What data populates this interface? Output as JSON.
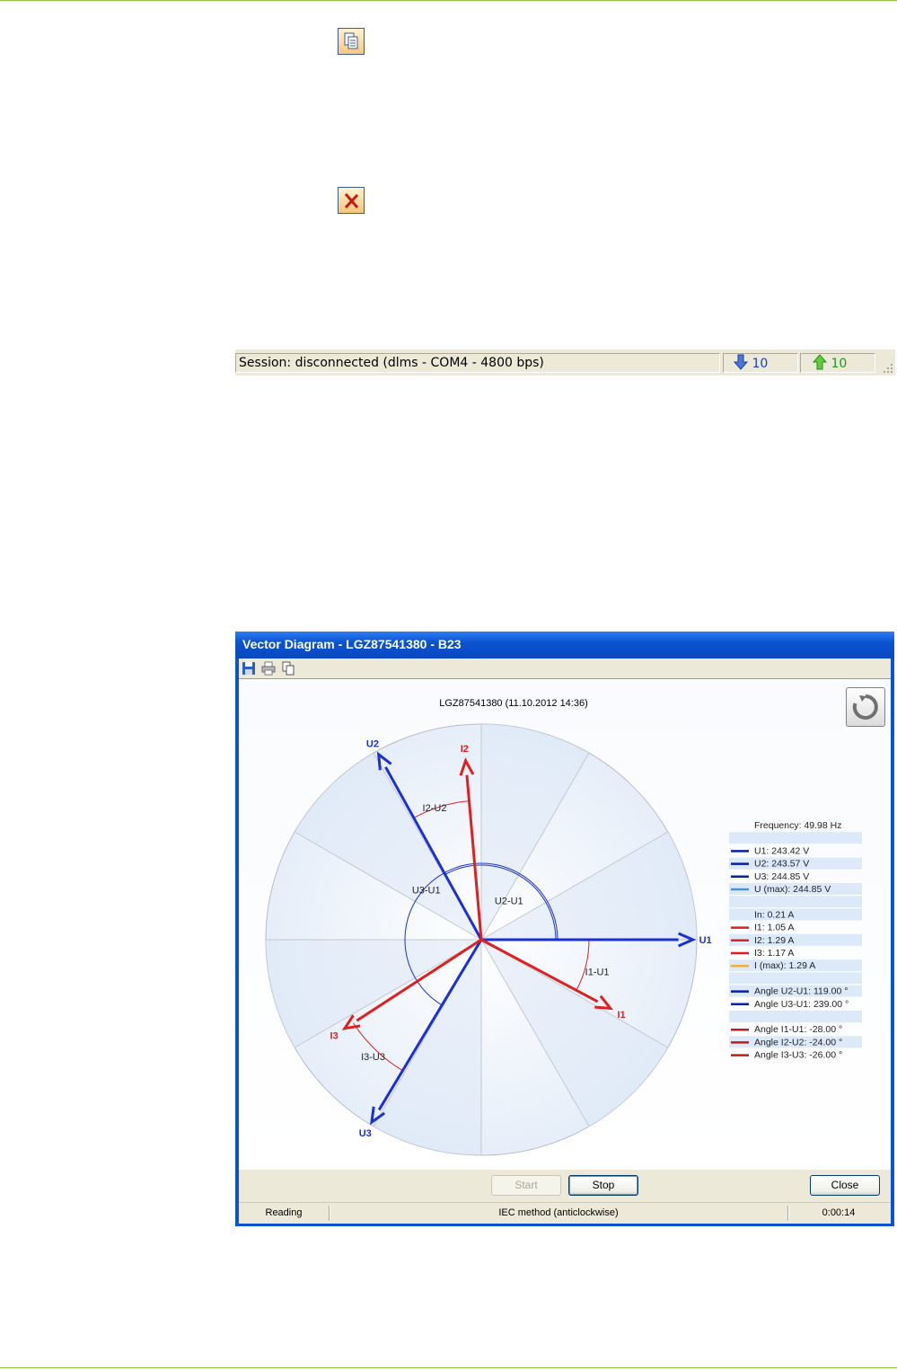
{
  "statusbar": {
    "session_text": "Session: disconnected (dlms - COM4 - 4800 bps)",
    "down_count": "10",
    "up_count": "10"
  },
  "dialog": {
    "title": "Vector Diagram - LGZ87541380 - B23",
    "chart_title": "LGZ87541380 (11.10.2012 14:36)",
    "buttons": {
      "start": "Start",
      "stop": "Stop",
      "close": "Close"
    },
    "status": {
      "state": "Reading",
      "method": "IEC method (anticlockwise)",
      "elapsed": "0:00:14"
    }
  },
  "chart_data": {
    "type": "vector",
    "vectors": [
      {
        "name": "U1",
        "kind": "voltage",
        "angle_deg": 0,
        "magnitude": 243.42,
        "color": "#1a2fd6"
      },
      {
        "name": "U2",
        "kind": "voltage",
        "angle_deg": 119,
        "magnitude": 243.57,
        "color": "#1a2fd6"
      },
      {
        "name": "U3",
        "kind": "voltage",
        "angle_deg": 239,
        "magnitude": 244.85,
        "color": "#1a2fd6"
      },
      {
        "name": "I1",
        "kind": "current",
        "angle_deg": -28,
        "magnitude": 1.05,
        "color": "#e02020"
      },
      {
        "name": "I2",
        "kind": "current",
        "angle_deg": 95,
        "magnitude": 1.29,
        "color": "#e02020"
      },
      {
        "name": "I3",
        "kind": "current",
        "angle_deg": 213,
        "magnitude": 1.17,
        "color": "#e02020"
      }
    ],
    "angle_labels": [
      "U2-U1",
      "U3-U1",
      "I1-U1",
      "I2-U2",
      "I3-U3"
    ],
    "legend": [
      {
        "text": "Frequency: 49.98 Hz",
        "color": ""
      },
      {
        "text": "",
        "color": ""
      },
      {
        "text": "U1: 243.42 V",
        "color": "#0a1fa8"
      },
      {
        "text": "U2: 243.57 V",
        "color": "#0a1fa8"
      },
      {
        "text": "U3: 244.85 V",
        "color": "#0a1fa8"
      },
      {
        "text": "U (max): 244.85 V",
        "color": "#4a90e0"
      },
      {
        "text": "",
        "color": ""
      },
      {
        "text": "In: 0.21 A",
        "color": ""
      },
      {
        "text": "I1: 1.05 A",
        "color": "#e02020"
      },
      {
        "text": "I2: 1.29 A",
        "color": "#e02020"
      },
      {
        "text": "I3: 1.17 A",
        "color": "#e02020"
      },
      {
        "text": "I (max): 1.29 A",
        "color": "#f0b040"
      },
      {
        "text": "",
        "color": ""
      },
      {
        "text": "Angle U2-U1: 119.00 °",
        "color": "#0a1fa8"
      },
      {
        "text": "Angle U3-U1: 239.00 °",
        "color": "#0a1fa8"
      },
      {
        "text": "",
        "color": ""
      },
      {
        "text": "Angle I1-U1: -28.00 °",
        "color": "#c81818"
      },
      {
        "text": "Angle I2-U2: -24.00 °",
        "color": "#c81818"
      },
      {
        "text": "Angle I3-U3: -26.00 °",
        "color": "#c81818"
      }
    ]
  }
}
